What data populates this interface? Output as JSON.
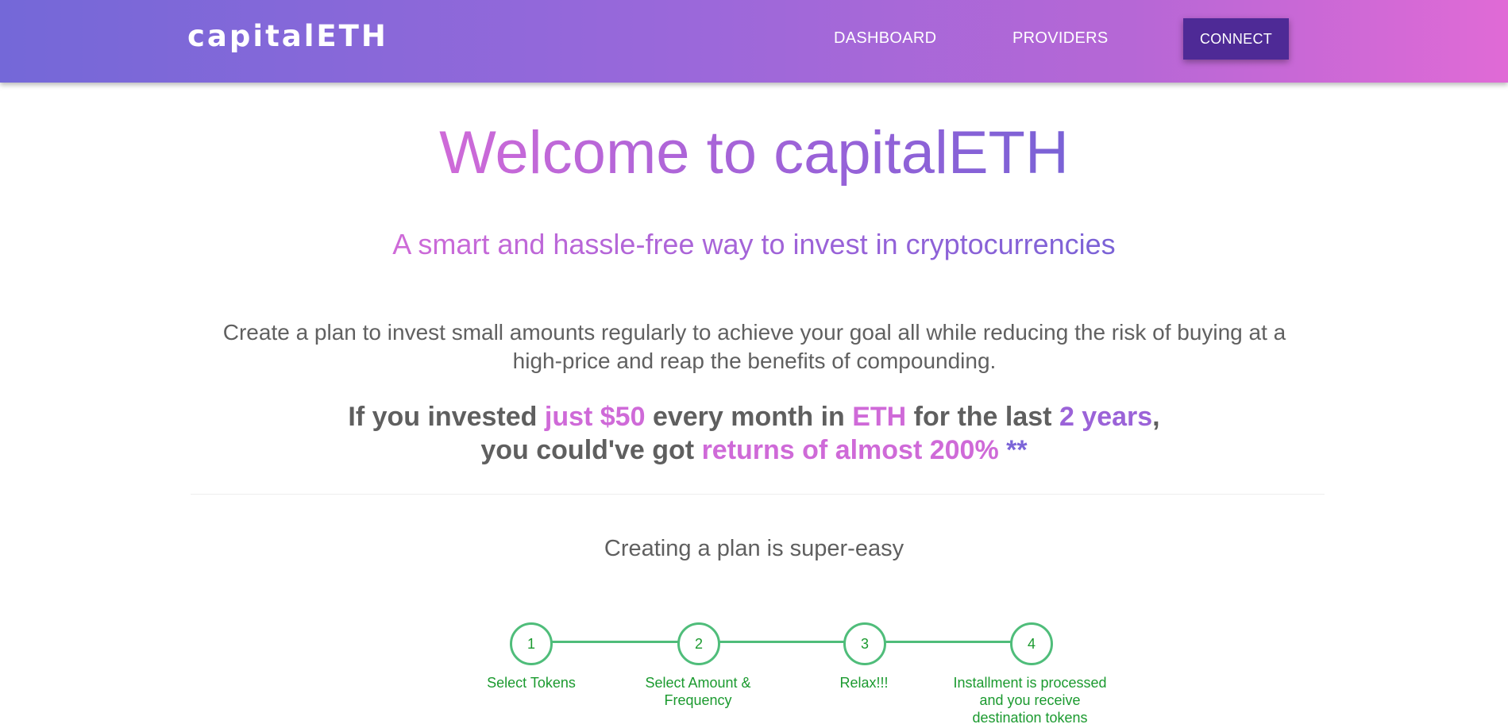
{
  "navbar": {
    "logo": "capitalETH",
    "links": [
      "DASHBOARD",
      "PROVIDERS"
    ],
    "connect_label": "CONNECT"
  },
  "hero": {
    "title": "Welcome to capitalETH",
    "subtitle": "A smart and hassle-free way to invest in cryptocurrencies",
    "description": "Create a plan to invest small amounts regularly to achieve your goal all while reducing the risk of buying at a high-price and reap the benefits of compounding.",
    "invest_line1": {
      "part1": "If you invested ",
      "amount": "just $50",
      "part2": " every month in ",
      "token": "ETH",
      "part3": " for the last ",
      "period": "2 years",
      "part4": ","
    },
    "invest_line2": {
      "part1": "you could've got ",
      "returns": "returns of almost 200%",
      "note": " **"
    }
  },
  "plan": {
    "heading": "Creating a plan is super-easy",
    "steps": [
      {
        "number": "1",
        "label": "Select Tokens"
      },
      {
        "number": "2",
        "label": "Select Amount & Frequency"
      },
      {
        "number": "3",
        "label": "Relax!!!"
      },
      {
        "number": "4",
        "label": "Installment is processed and you receive destination tokens"
      }
    ]
  },
  "colors": {
    "nav_gradient_start": "#7468d8",
    "nav_gradient_end": "#e06ad6",
    "connect_button": "#4e2a96",
    "accent_pink": "#cf6ad8",
    "accent_purple": "#7c65d8",
    "step_green": "#4fbd7a",
    "step_text": "#1b9a2f"
  }
}
